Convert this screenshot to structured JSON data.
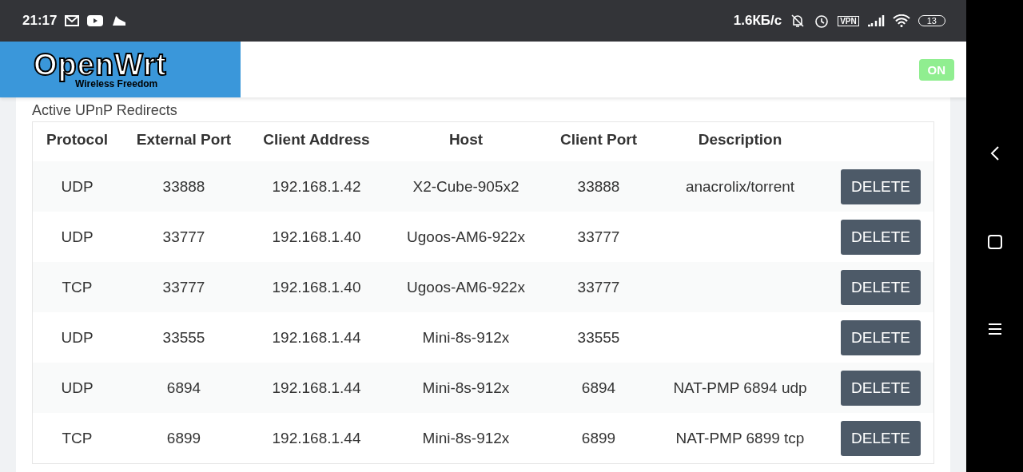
{
  "status_bar": {
    "time": "21:17",
    "speed": "1.6КБ/с",
    "vpn": "VPN",
    "battery": "13"
  },
  "header": {
    "logo_title": "OpenWrt",
    "logo_subtitle": "Wireless Freedom",
    "toggle": {
      "label": "ON",
      "on": true
    }
  },
  "section_title": "Active UPnP Redirects",
  "table": {
    "columns": [
      "Protocol",
      "External Port",
      "Client Address",
      "Host",
      "Client Port",
      "Description"
    ],
    "rows": [
      {
        "cells": [
          "UDP",
          "33888",
          "192.168.1.42",
          "X2-Cube-905x2",
          "33888",
          "anacrolix/torrent"
        ],
        "action": "DELETE"
      },
      {
        "cells": [
          "UDP",
          "33777",
          "192.168.1.40",
          "Ugoos-AM6-922x",
          "33777",
          ""
        ],
        "action": "DELETE"
      },
      {
        "cells": [
          "TCP",
          "33777",
          "192.168.1.40",
          "Ugoos-AM6-922x",
          "33777",
          ""
        ],
        "action": "DELETE"
      },
      {
        "cells": [
          "UDP",
          "33555",
          "192.168.1.44",
          "Mini-8s-912x",
          "33555",
          ""
        ],
        "action": "DELETE"
      },
      {
        "cells": [
          "UDP",
          "6894",
          "192.168.1.44",
          "Mini-8s-912x",
          "6894",
          "NAT-PMP 6894 udp"
        ],
        "action": "DELETE"
      },
      {
        "cells": [
          "TCP",
          "6899",
          "192.168.1.44",
          "Mini-8s-912x",
          "6899",
          "NAT-PMP 6899 tcp"
        ],
        "action": "DELETE"
      }
    ]
  }
}
